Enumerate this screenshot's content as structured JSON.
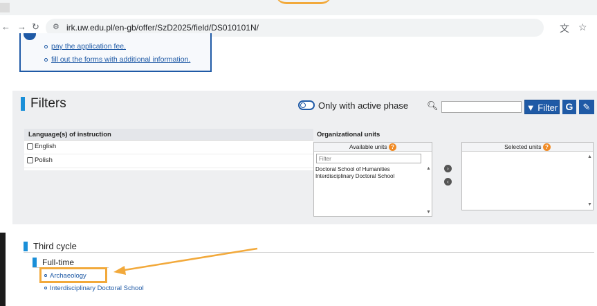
{
  "browser": {
    "url": "irk.uw.edu.pl/en-gb/offer/SzD2025/field/DS010101N/",
    "back_icon": "arrow-left-icon",
    "forward_icon": "arrow-right-icon",
    "reload_icon": "reload-icon",
    "translate_icon": "translate-icon",
    "bookmark_icon": "star-icon"
  },
  "info_box": {
    "items": [
      "pay the application fee.",
      "fill out the forms with additional information."
    ]
  },
  "filters": {
    "title": "Filters",
    "active_phase_label": "Only with active phase",
    "search_value": "",
    "filter_button": "Filter",
    "g_button": "G",
    "language_panel": {
      "header": "Language(s) of instruction",
      "options": [
        "English",
        "Polish"
      ]
    },
    "org_units": {
      "header": "Organizational units",
      "available_label": "Available units",
      "selected_label": "Selected units",
      "filter_placeholder": "Filter",
      "available_items": [
        "Doctoral School of Humanities",
        "Interdisciplinary Doctoral School"
      ]
    }
  },
  "results": {
    "cycle_title": "Third cycle",
    "mode_title": "Full-time",
    "programmes": [
      "Archaeology",
      "Interdisciplinary Doctoral School"
    ]
  },
  "colors": {
    "accent_blue": "#1f5aa6",
    "section_bar": "#1a8fd8",
    "highlight_orange": "#f2a93b",
    "help_badge": "#f08a24"
  }
}
